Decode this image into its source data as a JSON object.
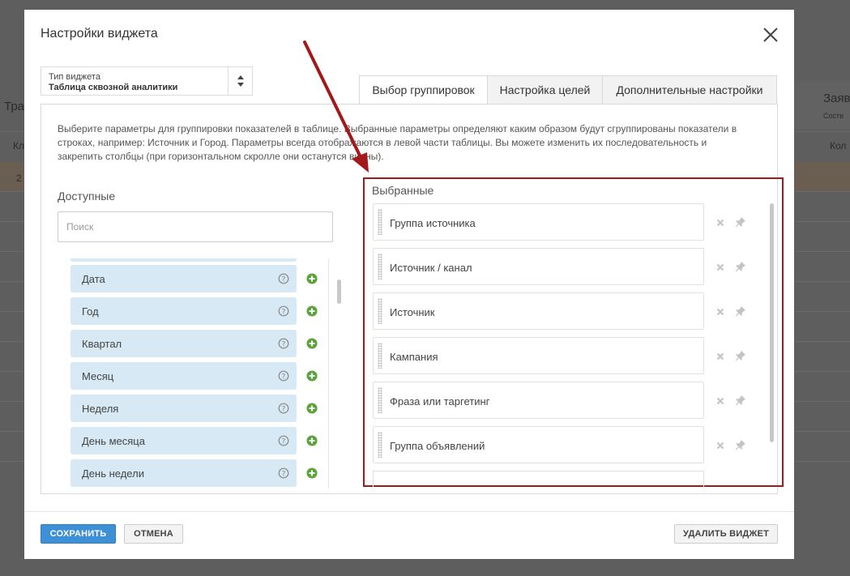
{
  "background": {
    "left_texts": [
      "Тра",
      "Кл",
      "2"
    ],
    "right_texts": [
      "Заяв",
      "Соств",
      "Кол"
    ]
  },
  "modal": {
    "title": "Настройки виджета",
    "widget_type": {
      "label": "Тип виджета",
      "value": "Таблица сквозной аналитики"
    },
    "tabs": [
      {
        "label": "Выбор группировок",
        "active": true
      },
      {
        "label": "Настройка целей",
        "active": false
      },
      {
        "label": "Дополнительные настройки",
        "active": false
      }
    ],
    "description": "Выберите параметры для группировки показателей в таблице. Выбранные параметры определяют каким образом будут сгруппированы показатели в строках, например: Источник и Город. Параметры всегда отображаются в левой части таблицы. Вы можете изменить их последовательность и закрепить столбцы (при горизонтальном скролле они останутся видны).",
    "available": {
      "title": "Доступные",
      "search_placeholder": "Поиск",
      "items": [
        "Дата",
        "Год",
        "Квартал",
        "Месяц",
        "Неделя",
        "День месяца",
        "День недели"
      ]
    },
    "selected": {
      "title": "Выбранные",
      "items": [
        "Группа источника",
        "Источник / канал",
        "Источник",
        "Кампания",
        "Фраза или таргетинг",
        "Группа объявлений"
      ]
    },
    "buttons": {
      "save": "СОХРАНИТЬ",
      "cancel": "ОТМЕНА",
      "delete": "УДАЛИТЬ ВИДЖЕТ"
    }
  },
  "colors": {
    "primary": "#3d8fd6",
    "item_bg": "#d6e9f5",
    "add_green": "#5aa33a",
    "highlight_red": "#9e1c1c"
  },
  "icons": [
    "close-icon",
    "sort-arrows-icon",
    "help-icon",
    "plus-circle-icon",
    "drag-handle-icon",
    "remove-icon",
    "pin-icon"
  ]
}
